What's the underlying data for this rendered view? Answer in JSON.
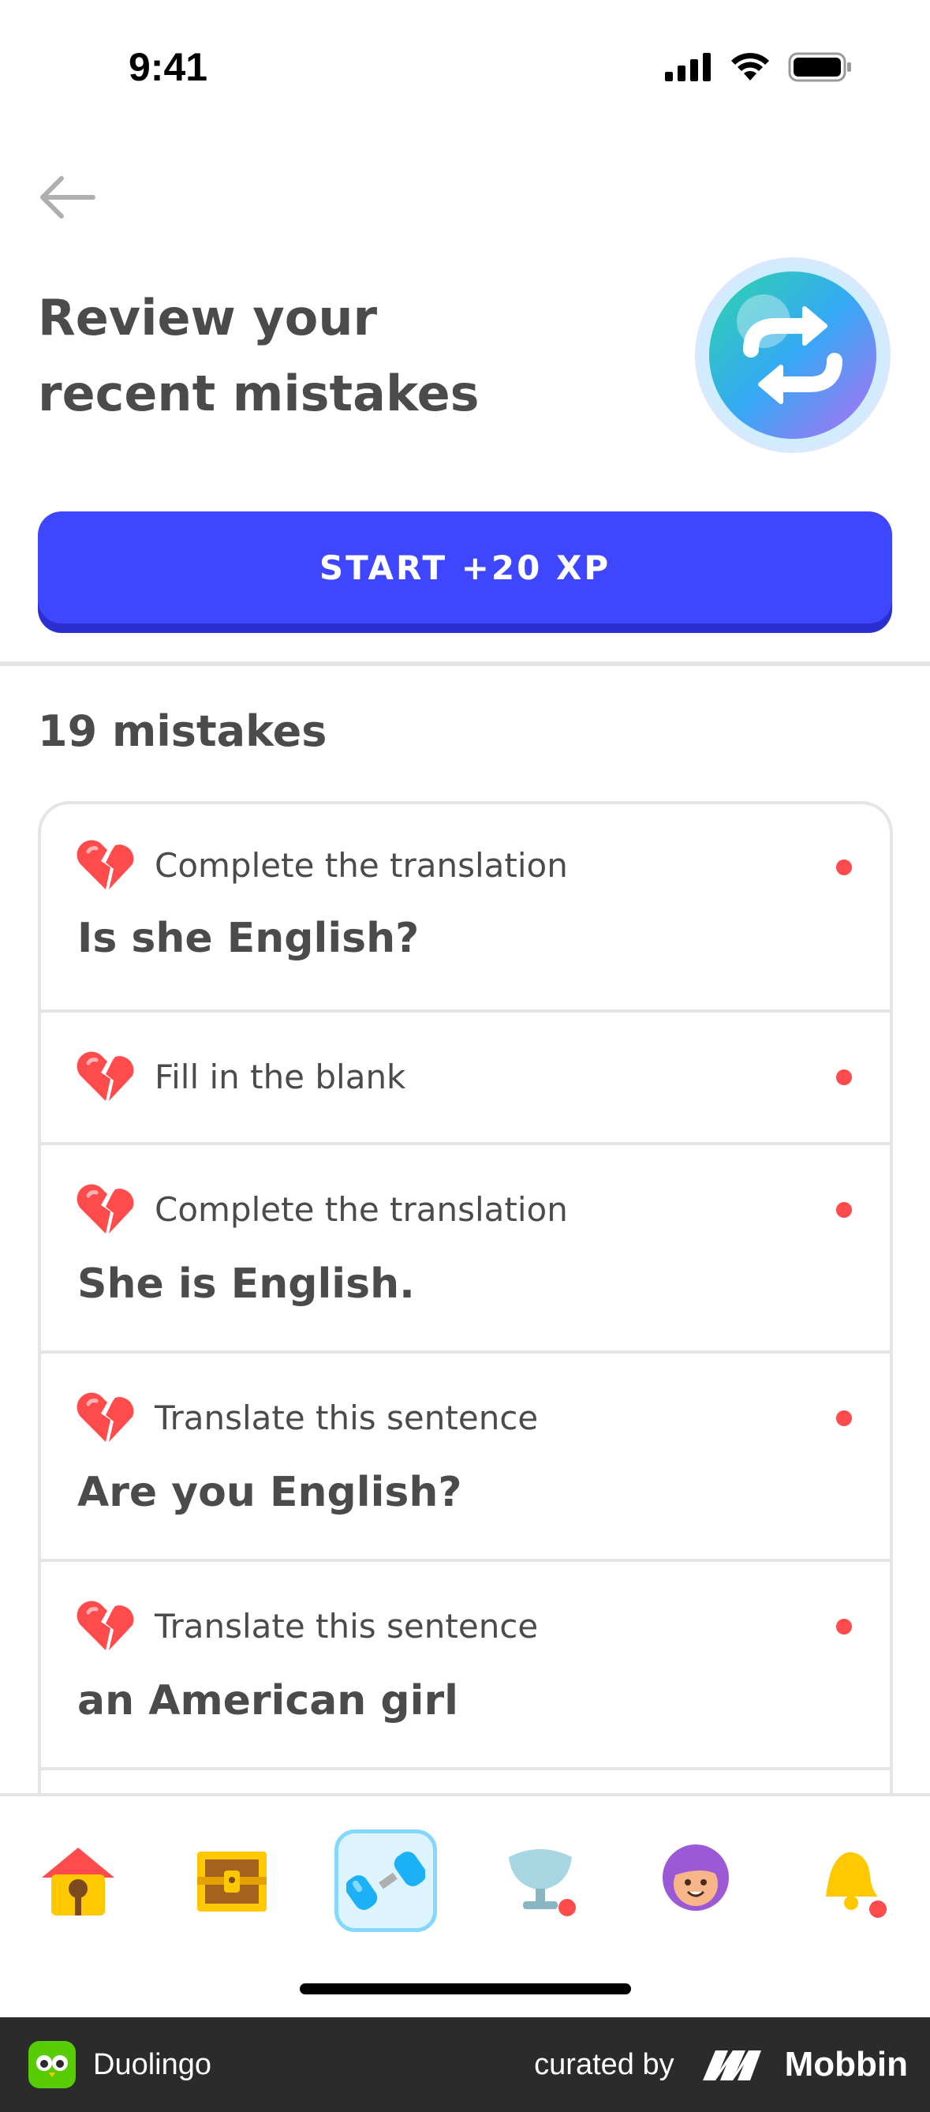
{
  "status_bar": {
    "time": "9:41"
  },
  "header": {
    "title_line1": "Review your",
    "title_line2": "recent mistakes"
  },
  "start_button": {
    "label": "START +20 XP"
  },
  "mistakes_count": "19 mistakes",
  "mistakes": [
    {
      "type": "Complete the translation",
      "text": "Is she English?"
    },
    {
      "type": "Fill in the blank",
      "text": ""
    },
    {
      "type": "Complete the translation",
      "text": "She is English."
    },
    {
      "type": "Translate this sentence",
      "text": "Are you English?"
    },
    {
      "type": "Translate this sentence",
      "text": "an American girl"
    }
  ],
  "tabs": [
    {
      "name": "home-icon"
    },
    {
      "name": "treasure-chest-icon"
    },
    {
      "name": "practice-dumbbell-icon",
      "active": true
    },
    {
      "name": "leaderboard-trophy-icon"
    },
    {
      "name": "profile-avatar-icon"
    },
    {
      "name": "notifications-bell-icon"
    }
  ],
  "footer": {
    "app_name": "Duolingo",
    "curated_by": "curated by",
    "brand": "Mobbin"
  },
  "colors": {
    "primary": "#3f46ff",
    "danger": "#ff4b4b",
    "active_tab_border": "#84d8ff"
  }
}
